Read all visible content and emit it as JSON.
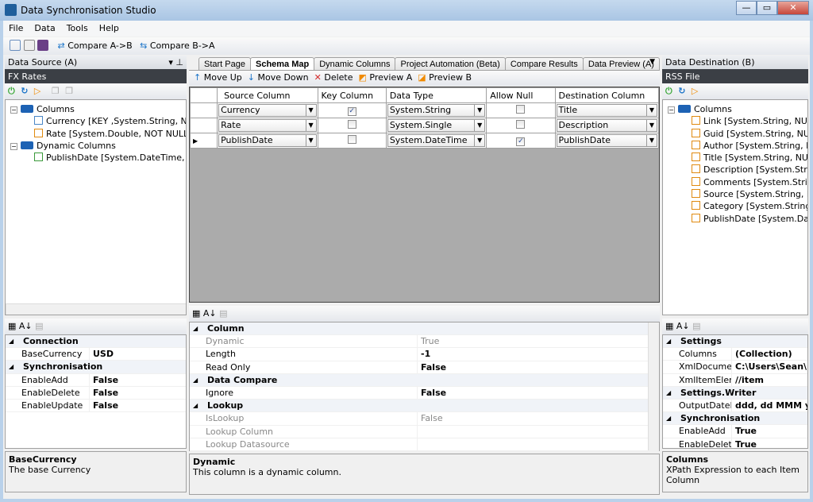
{
  "window": {
    "title": "Data Synchronisation Studio",
    "min": "—",
    "max": "▭",
    "close": "✕"
  },
  "menu": [
    "File",
    "Data",
    "Tools",
    "Help"
  ],
  "toolbar": {
    "compare_ab": "Compare A->B",
    "compare_ba": "Compare B->A"
  },
  "source": {
    "header": "Data Source (A)",
    "name": "FX Rates",
    "tree": {
      "columns_label": "Columns",
      "columns": [
        "Currency [KEY ,System.String, NOT NULL]",
        "Rate [System.Double, NOT NULL]"
      ],
      "dynamic_label": "Dynamic Columns",
      "dynamic": [
        "PublishDate [System.DateTime, NULL]"
      ]
    },
    "properties": [
      {
        "category": "Connection",
        "items": [
          [
            "BaseCurrency",
            "USD"
          ]
        ]
      },
      {
        "category": "Synchronisation",
        "items": [
          [
            "EnableAdd",
            "False"
          ],
          [
            "EnableDelete",
            "False"
          ],
          [
            "EnableUpdate",
            "False"
          ]
        ]
      }
    ],
    "desc_title": "BaseCurrency",
    "desc_text": "The base Currency"
  },
  "tabs": [
    "Start Page",
    "Schema Map",
    "Dynamic Columns",
    "Project Automation (Beta)",
    "Compare Results",
    "Data Preview (A)"
  ],
  "active_tab": "Schema Map",
  "schema_toolbar": {
    "move_up": "Move Up",
    "move_down": "Move Down",
    "delete": "Delete",
    "preview_a": "Preview A",
    "preview_b": "Preview B"
  },
  "grid": {
    "headers": [
      "Source Column",
      "Key Column",
      "Data Type",
      "Allow Null",
      "Destination Column"
    ],
    "rows": [
      {
        "source": "Currency",
        "key": true,
        "type": "System.String",
        "null": false,
        "dest": "Title"
      },
      {
        "source": "Rate",
        "key": false,
        "type": "System.Single",
        "null": false,
        "dest": "Description"
      },
      {
        "source": "PublishDate",
        "key": false,
        "type": "System.DateTime",
        "null": true,
        "dest": "PublishDate",
        "current": true
      }
    ]
  },
  "center_props": {
    "groups": [
      {
        "category": "Column",
        "items": [
          [
            "Dynamic",
            "True",
            true
          ],
          [
            "Length",
            "-1",
            false
          ],
          [
            "Read Only",
            "False",
            false
          ]
        ]
      },
      {
        "category": "Data Compare",
        "items": [
          [
            "Ignore",
            "False",
            false
          ]
        ]
      },
      {
        "category": "Lookup",
        "items": [
          [
            "IsLookup",
            "False",
            true
          ],
          [
            "Lookup Column",
            "",
            true
          ],
          [
            "Lookup Datasource",
            "",
            true
          ]
        ]
      }
    ],
    "desc_title": "Dynamic",
    "desc_text": "This column is a dynamic column."
  },
  "dest": {
    "header": "Data Destination (B)",
    "name": "RSS File",
    "columns_label": "Columns",
    "columns": [
      "Link [System.String, NULL]",
      "Guid [System.String, NULL]",
      "Author [System.String, NULL]",
      "Title [System.String, NULL]",
      "Description [System.String, NULL]",
      "Comments [System.String, NULL]",
      "Source [System.String, NULL]",
      "Category [System.String, NULL]",
      "PublishDate [System.DateTime, NULL]"
    ],
    "properties": [
      {
        "category": "Settings",
        "items": [
          [
            "Columns",
            "(Collection)"
          ],
          [
            "XmlDocument",
            "C:\\Users\\Sean\\Desktop"
          ],
          [
            "XmlItemElement",
            "//item"
          ]
        ]
      },
      {
        "category": "Settings.Writer",
        "items": [
          [
            "OutputDateFormat",
            "ddd, dd MMM yyyy"
          ]
        ]
      },
      {
        "category": "Synchronisation",
        "items": [
          [
            "EnableAdd",
            "True"
          ],
          [
            "EnableDelete",
            "True"
          ]
        ]
      }
    ],
    "desc_title": "Columns",
    "desc_text": "XPath Expression to each Item Column"
  }
}
